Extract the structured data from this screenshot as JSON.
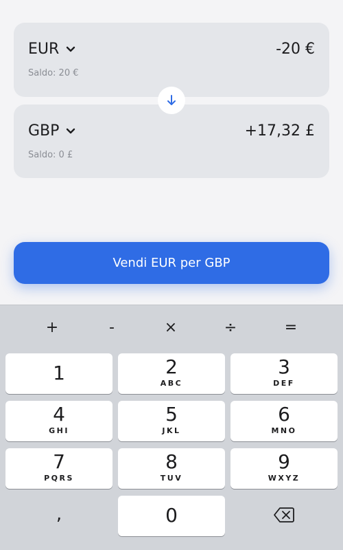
{
  "from": {
    "currency": "EUR",
    "amount": "-20 €",
    "balance": "Saldo: 20 €"
  },
  "to": {
    "currency": "GBP",
    "amount": "+17,32 £",
    "balance": "Saldo: 0 £"
  },
  "action": {
    "label": "Vendi EUR per GBP"
  },
  "keyboard": {
    "ops": [
      "+",
      "-",
      "×",
      "÷",
      "="
    ],
    "keys": [
      {
        "digit": "1",
        "letters": ""
      },
      {
        "digit": "2",
        "letters": "ABC"
      },
      {
        "digit": "3",
        "letters": "DEF"
      },
      {
        "digit": "4",
        "letters": "GHI"
      },
      {
        "digit": "5",
        "letters": "JKL"
      },
      {
        "digit": "6",
        "letters": "MNO"
      },
      {
        "digit": "7",
        "letters": "PQRS"
      },
      {
        "digit": "8",
        "letters": "TUV"
      },
      {
        "digit": "9",
        "letters": "WXYZ"
      },
      {
        "digit": "0",
        "letters": ""
      }
    ],
    "comma": ",",
    "delete_icon": "backspace-icon"
  },
  "colors": {
    "accent": "#2f6ce5",
    "card": "#e4e6ea",
    "keyboard": "#d1d4d9"
  }
}
